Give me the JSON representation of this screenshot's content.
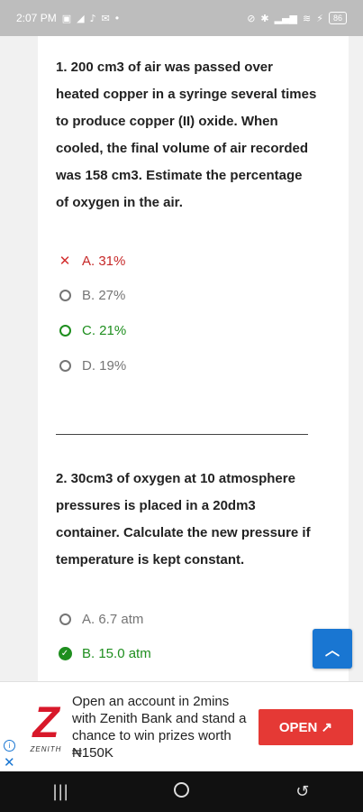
{
  "status_bar": {
    "time": "2:07 PM",
    "left_icons": [
      "linkedin-icon",
      "telegram-icon",
      "tiktok-icon",
      "mail-icon"
    ],
    "dot": "•",
    "right_icons": [
      "mute-icon",
      "bluetooth-icon",
      "signal-icon",
      "wifi-icon"
    ],
    "battery": "86"
  },
  "questions": [
    {
      "text": "1. 200 cm3 of air was passed over heated copper in a syringe several times to produce copper (II) oxide. When cooled, the final volume of air recorded was 158 cm3. Estimate the percentage of oxygen in the air.",
      "options": [
        {
          "label": "A. 31%",
          "state": "wrong"
        },
        {
          "label": "B. 27%",
          "state": "neutral"
        },
        {
          "label": "C. 21%",
          "state": "correct"
        },
        {
          "label": "D. 19%",
          "state": "neutral"
        }
      ]
    },
    {
      "text": "2. 30cm3 of oxygen at 10 atmosphere pressures is placed in a 20dm3 container. Calculate the new pressure if temperature is kept constant.",
      "options": [
        {
          "label": "A. 6.7 atm",
          "state": "neutral"
        },
        {
          "label": "B. 15.0 atm",
          "state": "selected-correct"
        }
      ]
    }
  ],
  "scroll_top_icon": "chevron-up-icon",
  "ad": {
    "brand": "ZENITH",
    "logo_letter": "Z",
    "text": "Open an account in 2mins with Zenith Bank and stand a chance to win prizes worth ₦150K",
    "button_label": "OPEN ↗",
    "colors": {
      "brand_red": "#d8182a",
      "button": "#e53935"
    }
  },
  "nav": {
    "recents_icon": "|||",
    "back_icon": "↺"
  },
  "colors": {
    "correct": "#1e8e1e",
    "wrong": "#c62828",
    "neutral": "#757575",
    "accent_blue": "#1976d2"
  }
}
